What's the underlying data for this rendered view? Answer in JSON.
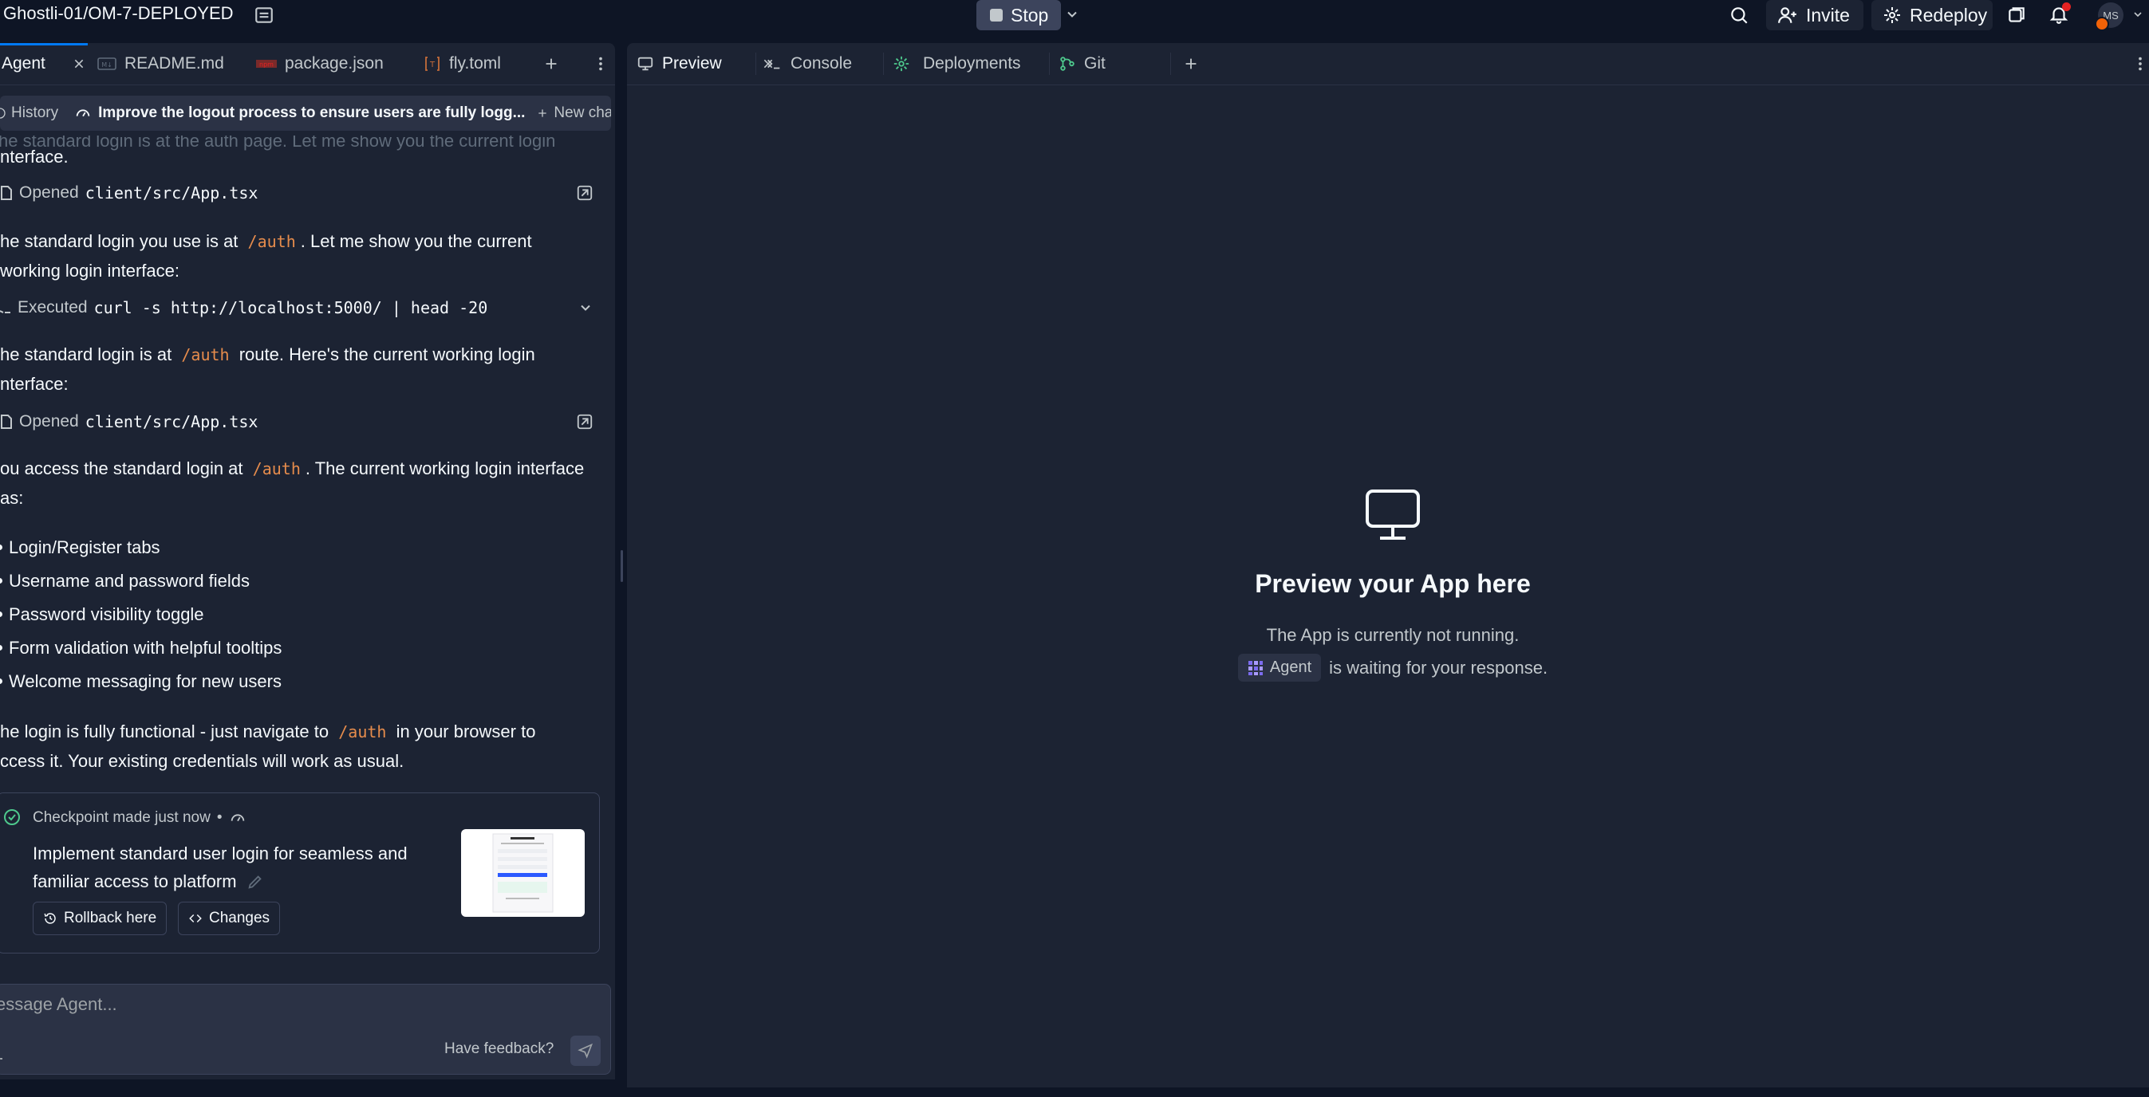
{
  "topbar": {
    "project_name": "Ghostli-01/OM-7-DEPLOYED",
    "stop_label": "Stop",
    "invite_label": "Invite",
    "redeploy_label": "Redeploy",
    "avatar_initials": "MS"
  },
  "left_tabs": [
    {
      "label": "Agent",
      "icon": "agent-icon",
      "active": true,
      "closable": true
    },
    {
      "label": "README.md",
      "icon": "markdown-file-icon"
    },
    {
      "label": "package.json",
      "icon": "npm-file-icon"
    },
    {
      "label": "fly.toml",
      "icon": "toml-file-icon"
    }
  ],
  "history_bar": {
    "history_label": "History",
    "chat_title": "Improve the logout process to ensure users are fully logg...",
    "new_chat_label": "New chat"
  },
  "chat": {
    "cut_top_line": "he standard login is at the auth page. Let me show you the current login",
    "line_interface": "nterface.",
    "opened_label_1": "Opened",
    "opened_file_1": "client/src/App.tsx",
    "msg2_part1": "he standard login you use is at",
    "code_auth": "/auth",
    "msg2_part2": ". Let me show you the current",
    "msg2_line2": "working login interface:",
    "executed_label": "Executed",
    "executed_cmd": "curl -s http://localhost:5000/ | head -20",
    "msg3_part1": "he standard login is at",
    "msg3_part2": "route. Here's the current working login",
    "msg3_line2": "nterface:",
    "opened_label_2": "Opened",
    "opened_file_2": "client/src/App.tsx",
    "msg4_part1": "ou access the standard login at",
    "msg4_part2": ". The current working login interface",
    "msg4_line2": "as:",
    "bullets": [
      "Login/Register tabs",
      "Username and password fields",
      "Password visibility toggle",
      "Form validation with helpful tooltips",
      "Welcome messaging for new users"
    ],
    "msg5_part1": "he login is fully functional - just navigate to",
    "msg5_part2": "in your browser to",
    "msg5_line2": "ccess it. Your existing credentials will work as usual."
  },
  "checkpoint": {
    "status": "Checkpoint made just now",
    "separator": "•",
    "title_line1": "Implement standard user login for seamless and",
    "title_line2": "familiar access to platform",
    "rollback_label": "Rollback here",
    "changes_label": "Changes"
  },
  "composer": {
    "placeholder": "essage Agent...",
    "feedback_label": "Have feedback?"
  },
  "right_tabs": [
    {
      "label": "Preview",
      "icon": "monitor-icon",
      "active": true,
      "closable": true
    },
    {
      "label": "Console",
      "icon": "terminal-icon"
    },
    {
      "label": "Deployments",
      "icon": "deploy-icon"
    },
    {
      "label": "Git",
      "icon": "git-icon"
    }
  ],
  "preview": {
    "heading": "Preview your App here",
    "line1": "The App is currently not running.",
    "agent_chip": "Agent",
    "line2": "is waiting for your response."
  },
  "colors": {
    "background": "#0e1525",
    "panel": "#1c2333",
    "accent_blue": "#0079f2",
    "inline_code": "#e68c4c",
    "success_green": "#4ec98d",
    "notification_red": "#e52222"
  }
}
